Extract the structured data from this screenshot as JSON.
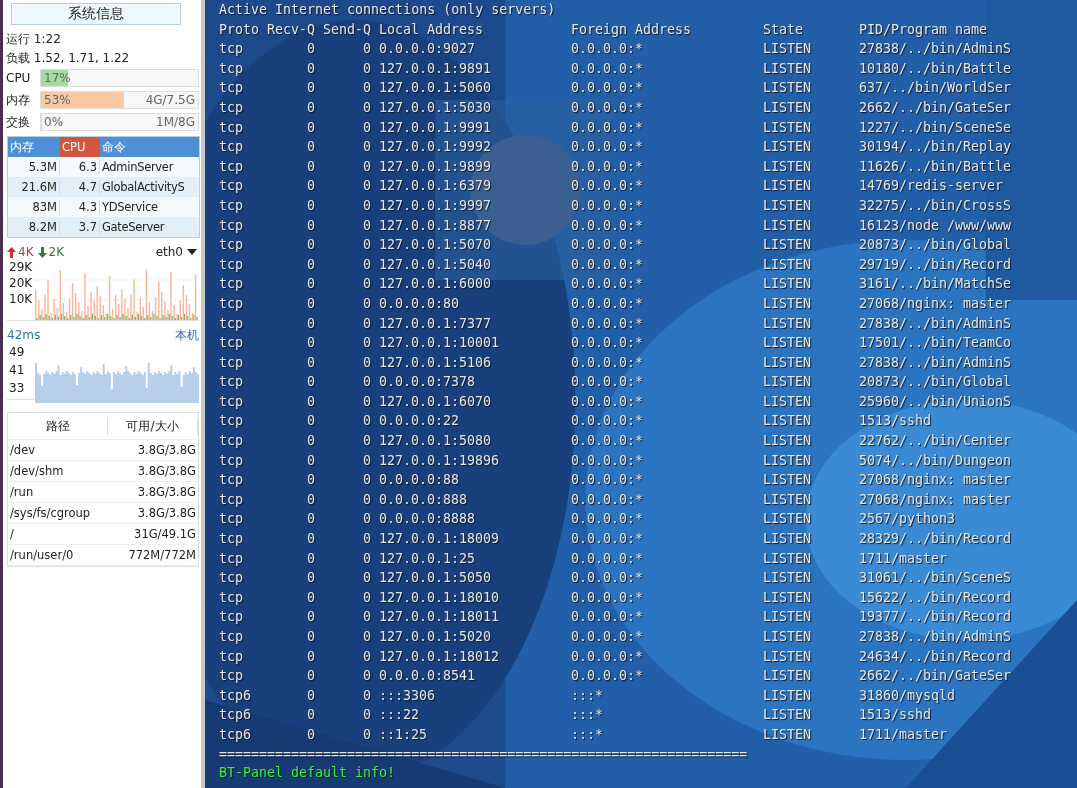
{
  "sidebar": {
    "title_button": "系统信息",
    "uptime": "运行 1:22",
    "load": "负载 1.52, 1.71, 1.22",
    "gauges": [
      {
        "label": "CPU",
        "level": 0.17,
        "percent": "17%",
        "color": "#a6dba0"
      },
      {
        "label": "内存",
        "level": 0.53,
        "percent": "53%",
        "amount": "4G/7.5G",
        "color": "#f9c9a2"
      },
      {
        "label": "交换",
        "level": 0,
        "percent": "0%",
        "amount": "1M/8G"
      }
    ],
    "processes": {
      "columns": [
        {
          "label": "内存",
          "color": "#4f8fd6"
        },
        {
          "label": "CPU",
          "color": "#d2553f"
        },
        {
          "label": "命令",
          "color": "#4f8fd6"
        }
      ],
      "rows": [
        [
          "5.3M",
          "6.3",
          "AdminServer"
        ],
        [
          "21.6M",
          "4.7",
          "GlobalActivityS"
        ],
        [
          "83M",
          "4.3",
          "YDService"
        ],
        [
          "8.2M",
          "3.7",
          "GateServer"
        ]
      ]
    },
    "network": {
      "up": "4K",
      "down": "2K",
      "interface": "eth0",
      "y_labels": [
        "29K",
        "20K",
        "10K"
      ]
    },
    "ping": {
      "latency": "42ms",
      "target": "本机",
      "y_labels": [
        "49",
        "41",
        "33"
      ]
    },
    "disks": {
      "columns": [
        "路径",
        "可用/大小"
      ],
      "rows": [
        {
          "path": "/dev",
          "size": "3.8G/3.8G"
        },
        {
          "path": "/dev/shm",
          "size": "3.8G/3.8G"
        },
        {
          "path": "/run",
          "size": "3.8G/3.8G"
        },
        {
          "path": "/sys/fs/cgroup",
          "size": "3.8G/3.8G"
        },
        {
          "path": "/",
          "size": "31G/49.1G"
        },
        {
          "path": "/run/user/0",
          "size": "772M/772M"
        }
      ]
    }
  },
  "terminal": {
    "title_line": "Active Internet connections (only servers)",
    "columns": [
      "Proto",
      "Recv-Q",
      "Send-Q",
      "Local Address",
      "Foreign Address",
      "State",
      "PID/Program name"
    ],
    "rows": [
      [
        "tcp",
        "0",
        "0",
        "0.0.0.0:9027",
        "0.0.0.0:*",
        "LISTEN",
        "27838/../bin/AdminS"
      ],
      [
        "tcp",
        "0",
        "0",
        "127.0.0.1:9891",
        "0.0.0.0:*",
        "LISTEN",
        "10180/../bin/Battle"
      ],
      [
        "tcp",
        "0",
        "0",
        "127.0.0.1:5060",
        "0.0.0.0:*",
        "LISTEN",
        "637/../bin/WorldSer"
      ],
      [
        "tcp",
        "0",
        "0",
        "127.0.0.1:5030",
        "0.0.0.0:*",
        "LISTEN",
        "2662/../bin/GateSer"
      ],
      [
        "tcp",
        "0",
        "0",
        "127.0.0.1:9991",
        "0.0.0.0:*",
        "LISTEN",
        "1227/../bin/SceneSe"
      ],
      [
        "tcp",
        "0",
        "0",
        "127.0.0.1:9992",
        "0.0.0.0:*",
        "LISTEN",
        "30194/../bin/Replay"
      ],
      [
        "tcp",
        "0",
        "0",
        "127.0.0.1:9899",
        "0.0.0.0:*",
        "LISTEN",
        "11626/../bin/Battle"
      ],
      [
        "tcp",
        "0",
        "0",
        "127.0.0.1:6379",
        "0.0.0.0:*",
        "LISTEN",
        "14769/redis-server"
      ],
      [
        "tcp",
        "0",
        "0",
        "127.0.0.1:9997",
        "0.0.0.0:*",
        "LISTEN",
        "32275/../bin/CrossS"
      ],
      [
        "tcp",
        "0",
        "0",
        "127.0.0.1:8877",
        "0.0.0.0:*",
        "LISTEN",
        "16123/node /www/www"
      ],
      [
        "tcp",
        "0",
        "0",
        "127.0.0.1:5070",
        "0.0.0.0:*",
        "LISTEN",
        "20873/../bin/Global"
      ],
      [
        "tcp",
        "0",
        "0",
        "127.0.0.1:5040",
        "0.0.0.0:*",
        "LISTEN",
        "29719/../bin/Record"
      ],
      [
        "tcp",
        "0",
        "0",
        "127.0.0.1:6000",
        "0.0.0.0:*",
        "LISTEN",
        "3161/../bin/MatchSe"
      ],
      [
        "tcp",
        "0",
        "0",
        "0.0.0.0:80",
        "0.0.0.0:*",
        "LISTEN",
        "27068/nginx: master"
      ],
      [
        "tcp",
        "0",
        "0",
        "127.0.0.1:7377",
        "0.0.0.0:*",
        "LISTEN",
        "27838/../bin/AdminS"
      ],
      [
        "tcp",
        "0",
        "0",
        "127.0.0.1:10001",
        "0.0.0.0:*",
        "LISTEN",
        "17501/../bin/TeamCo"
      ],
      [
        "tcp",
        "0",
        "0",
        "127.0.0.1:5106",
        "0.0.0.0:*",
        "LISTEN",
        "27838/../bin/AdminS"
      ],
      [
        "tcp",
        "0",
        "0",
        "0.0.0.0:7378",
        "0.0.0.0:*",
        "LISTEN",
        "20873/../bin/Global"
      ],
      [
        "tcp",
        "0",
        "0",
        "127.0.0.1:6070",
        "0.0.0.0:*",
        "LISTEN",
        "25960/../bin/UnionS"
      ],
      [
        "tcp",
        "0",
        "0",
        "0.0.0.0:22",
        "0.0.0.0:*",
        "LISTEN",
        "1513/sshd"
      ],
      [
        "tcp",
        "0",
        "0",
        "127.0.0.1:5080",
        "0.0.0.0:*",
        "LISTEN",
        "22762/../bin/Center"
      ],
      [
        "tcp",
        "0",
        "0",
        "127.0.0.1:19896",
        "0.0.0.0:*",
        "LISTEN",
        "5074/../bin/Dungeon"
      ],
      [
        "tcp",
        "0",
        "0",
        "0.0.0.0:88",
        "0.0.0.0:*",
        "LISTEN",
        "27068/nginx: master"
      ],
      [
        "tcp",
        "0",
        "0",
        "0.0.0.0:888",
        "0.0.0.0:*",
        "LISTEN",
        "27068/nginx: master"
      ],
      [
        "tcp",
        "0",
        "0",
        "0.0.0.0:8888",
        "0.0.0.0:*",
        "LISTEN",
        "2567/python3"
      ],
      [
        "tcp",
        "0",
        "0",
        "127.0.0.1:18009",
        "0.0.0.0:*",
        "LISTEN",
        "28329/../bin/Record"
      ],
      [
        "tcp",
        "0",
        "0",
        "127.0.0.1:25",
        "0.0.0.0:*",
        "LISTEN",
        "1711/master"
      ],
      [
        "tcp",
        "0",
        "0",
        "127.0.0.1:5050",
        "0.0.0.0:*",
        "LISTEN",
        "31061/../bin/SceneS"
      ],
      [
        "tcp",
        "0",
        "0",
        "127.0.0.1:18010",
        "0.0.0.0:*",
        "LISTEN",
        "15622/../bin/Record"
      ],
      [
        "tcp",
        "0",
        "0",
        "127.0.0.1:18011",
        "0.0.0.0:*",
        "LISTEN",
        "19377/../bin/Record"
      ],
      [
        "tcp",
        "0",
        "0",
        "127.0.0.1:5020",
        "0.0.0.0:*",
        "LISTEN",
        "27838/../bin/AdminS"
      ],
      [
        "tcp",
        "0",
        "0",
        "127.0.0.1:18012",
        "0.0.0.0:*",
        "LISTEN",
        "24634/../bin/Record"
      ],
      [
        "tcp",
        "0",
        "0",
        "0.0.0.0:8541",
        "0.0.0.0:*",
        "LISTEN",
        "2662/../bin/GateSer"
      ],
      [
        "tcp6",
        "0",
        "0",
        ":::3306",
        ":::*",
        "LISTEN",
        "31860/mysqld"
      ],
      [
        "tcp6",
        "0",
        "0",
        ":::22",
        ":::*",
        "LISTEN",
        "1513/sshd"
      ],
      [
        "tcp6",
        "0",
        "0",
        "::1:25",
        ":::*",
        "LISTEN",
        "1711/master"
      ]
    ],
    "separator": "==================================================================",
    "footer": "BT-Panel default info!"
  }
}
